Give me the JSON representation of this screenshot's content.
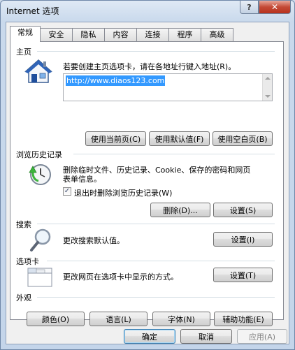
{
  "window": {
    "title": "Internet 选项",
    "help": "?",
    "close": "✕"
  },
  "tabs": [
    "常规",
    "安全",
    "隐私",
    "内容",
    "连接",
    "程序",
    "高级"
  ],
  "homepage": {
    "title": "主页",
    "description": "若要创建主页选项卡，请在各地址行键入地址(R)。",
    "url": "http://www.diaos123.com",
    "buttons": {
      "use_current": "使用当前页(C)",
      "use_default": "使用默认值(F)",
      "use_blank": "使用空白页(B)"
    },
    "icon": "home-icon"
  },
  "history": {
    "title": "浏览历史记录",
    "description_line1": "删除临时文件、历史记录、Cookie、保存的密码和网页",
    "description_line2": "表单信息。",
    "checkbox_label": "退出时删除浏览历史记录(W)",
    "checkbox_checked": true,
    "buttons": {
      "delete": "删除(D)...",
      "settings": "设置(S)"
    },
    "icon": "history-clock-icon"
  },
  "search": {
    "title": "搜索",
    "description": "更改搜索默认值。",
    "buttons": {
      "settings": "设置(I)"
    },
    "icon": "magnifier-icon"
  },
  "tabs_section": {
    "title": "选项卡",
    "description": "更改网页在选项卡中显示的方式。",
    "buttons": {
      "settings": "设置(T)"
    },
    "icon": "tabs-window-icon"
  },
  "appearance": {
    "title": "外观",
    "buttons": {
      "colors": "颜色(O)",
      "languages": "语言(L)",
      "fonts": "字体(N)",
      "accessibility": "辅助功能(E)"
    }
  },
  "footer": {
    "ok": "确定",
    "cancel": "取消",
    "apply": "应用(A)"
  },
  "colors": {
    "selection": "#3399ff",
    "accent_border": "#3c7fb1"
  }
}
